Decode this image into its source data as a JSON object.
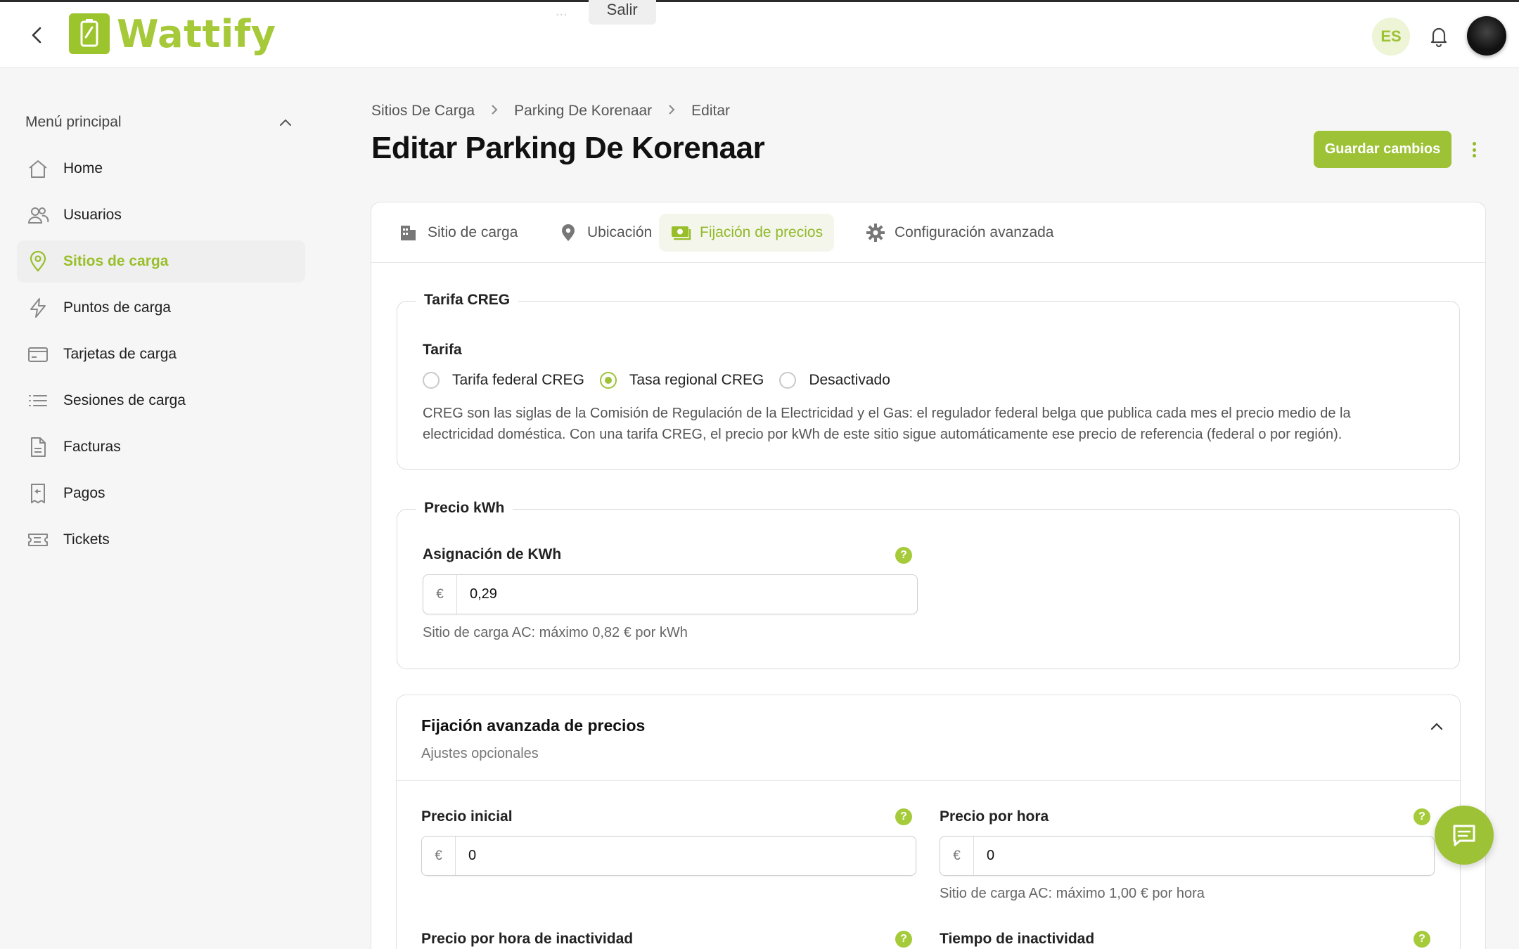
{
  "header": {
    "app_name": "Wattify",
    "banner_text": "...",
    "banner_button": "Salir",
    "language": "ES",
    "colors": {
      "brand": "#9dc235",
      "active_tab_bg": "#f4f6ec"
    }
  },
  "sidebar": {
    "title": "Menú principal",
    "items": [
      {
        "label": "Home",
        "icon": "home-icon",
        "active": false
      },
      {
        "label": "Usuarios",
        "icon": "users-icon",
        "active": false
      },
      {
        "label": "Sitios de carga",
        "icon": "location-pin-icon",
        "active": true
      },
      {
        "label": "Puntos de carga",
        "icon": "lightning-icon",
        "active": false
      },
      {
        "label": "Tarjetas de carga",
        "icon": "card-icon",
        "active": false
      },
      {
        "label": "Sesiones de carga",
        "icon": "list-icon",
        "active": false
      },
      {
        "label": "Facturas",
        "icon": "document-icon",
        "active": false
      },
      {
        "label": "Pagos",
        "icon": "receipt-icon",
        "active": false
      },
      {
        "label": "Tickets",
        "icon": "ticket-icon",
        "active": false
      }
    ]
  },
  "breadcrumb": [
    "Sitios De Carga",
    "Parking De Korenaar",
    "Editar"
  ],
  "page": {
    "title": "Editar Parking De Korenaar",
    "save_label": "Guardar cambios"
  },
  "tabs": [
    {
      "label": "Sitio de carga",
      "icon": "building-icon",
      "active": false
    },
    {
      "label": "Ubicación",
      "icon": "map-pin-icon",
      "active": false
    },
    {
      "label": "Fijación de precios",
      "icon": "money-icon",
      "active": true
    },
    {
      "label": "Configuración avanzada",
      "icon": "gear-icon",
      "active": false
    }
  ],
  "creg": {
    "legend": "Tarifa CREG",
    "label": "Tarifa",
    "options": [
      {
        "label": "Tarifa federal CREG",
        "checked": false
      },
      {
        "label": "Tasa regional CREG",
        "checked": true
      },
      {
        "label": "Desactivado",
        "checked": false
      }
    ],
    "description_line1": "CREG son las siglas de la Comisión de Regulación de la Electricidad y el Gas: el regulador federal belga que publica cada mes el precio medio de la",
    "description_line2": "electricidad doméstica. Con una tarifa CREG, el precio por kWh de este sitio sigue automáticamente ese precio de referencia (federal o por región)."
  },
  "kwh": {
    "legend": "Precio kWh",
    "label": "Asignación de KWh",
    "currency": "€",
    "value": "0,29",
    "hint": "Sitio de carga AC: máximo 0,82 € por kWh"
  },
  "advanced": {
    "title": "Fijación avanzada de precios",
    "subtitle": "Ajustes opcionales",
    "start_price": {
      "label": "Precio inicial",
      "currency": "€",
      "value": "0"
    },
    "hourly_price": {
      "label": "Precio por hora",
      "currency": "€",
      "value": "0",
      "hint": "Sitio de carga AC: máximo 1,00 € por hora"
    },
    "idle_hourly_price": {
      "label": "Precio por hora de inactividad"
    },
    "idle_time": {
      "label": "Tiempo de inactividad"
    },
    "help_glyph": "?"
  }
}
